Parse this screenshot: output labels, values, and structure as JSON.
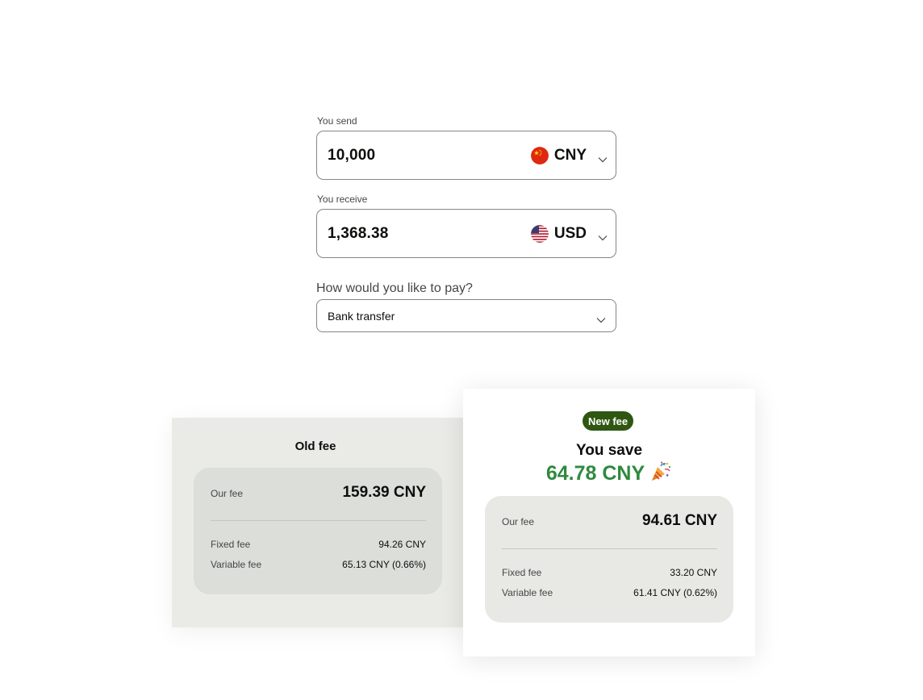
{
  "send": {
    "label": "You send",
    "amount": "10,000",
    "currency": "CNY",
    "flag_icon": "china-flag-icon"
  },
  "receive": {
    "label": "You receive",
    "amount": "1,368.38",
    "currency": "USD",
    "flag_icon": "usa-flag-icon"
  },
  "payment": {
    "label": "How would you like to pay?",
    "selected": "Bank transfer"
  },
  "old_fee": {
    "title": "Old fee",
    "our_fee_label": "Our fee",
    "our_fee_value": "159.39 CNY",
    "fixed_label": "Fixed fee",
    "fixed_value": "94.26 CNY",
    "variable_label": "Variable fee",
    "variable_value": "65.13 CNY (0.66%)"
  },
  "new_fee": {
    "badge": "New fee",
    "save_label": "You save",
    "save_amount": "64.78 CNY",
    "save_icon": "party-popper-icon",
    "our_fee_label": "Our fee",
    "our_fee_value": "94.61 CNY",
    "fixed_label": "Fixed fee",
    "fixed_value": "33.20 CNY",
    "variable_label": "Variable fee",
    "variable_value": "61.41 CNY (0.62%)"
  },
  "colors": {
    "accent_green": "#2f8a3e",
    "badge_green": "#2f5711",
    "panel_grey": "#e8e9e5",
    "border": "#868685"
  }
}
